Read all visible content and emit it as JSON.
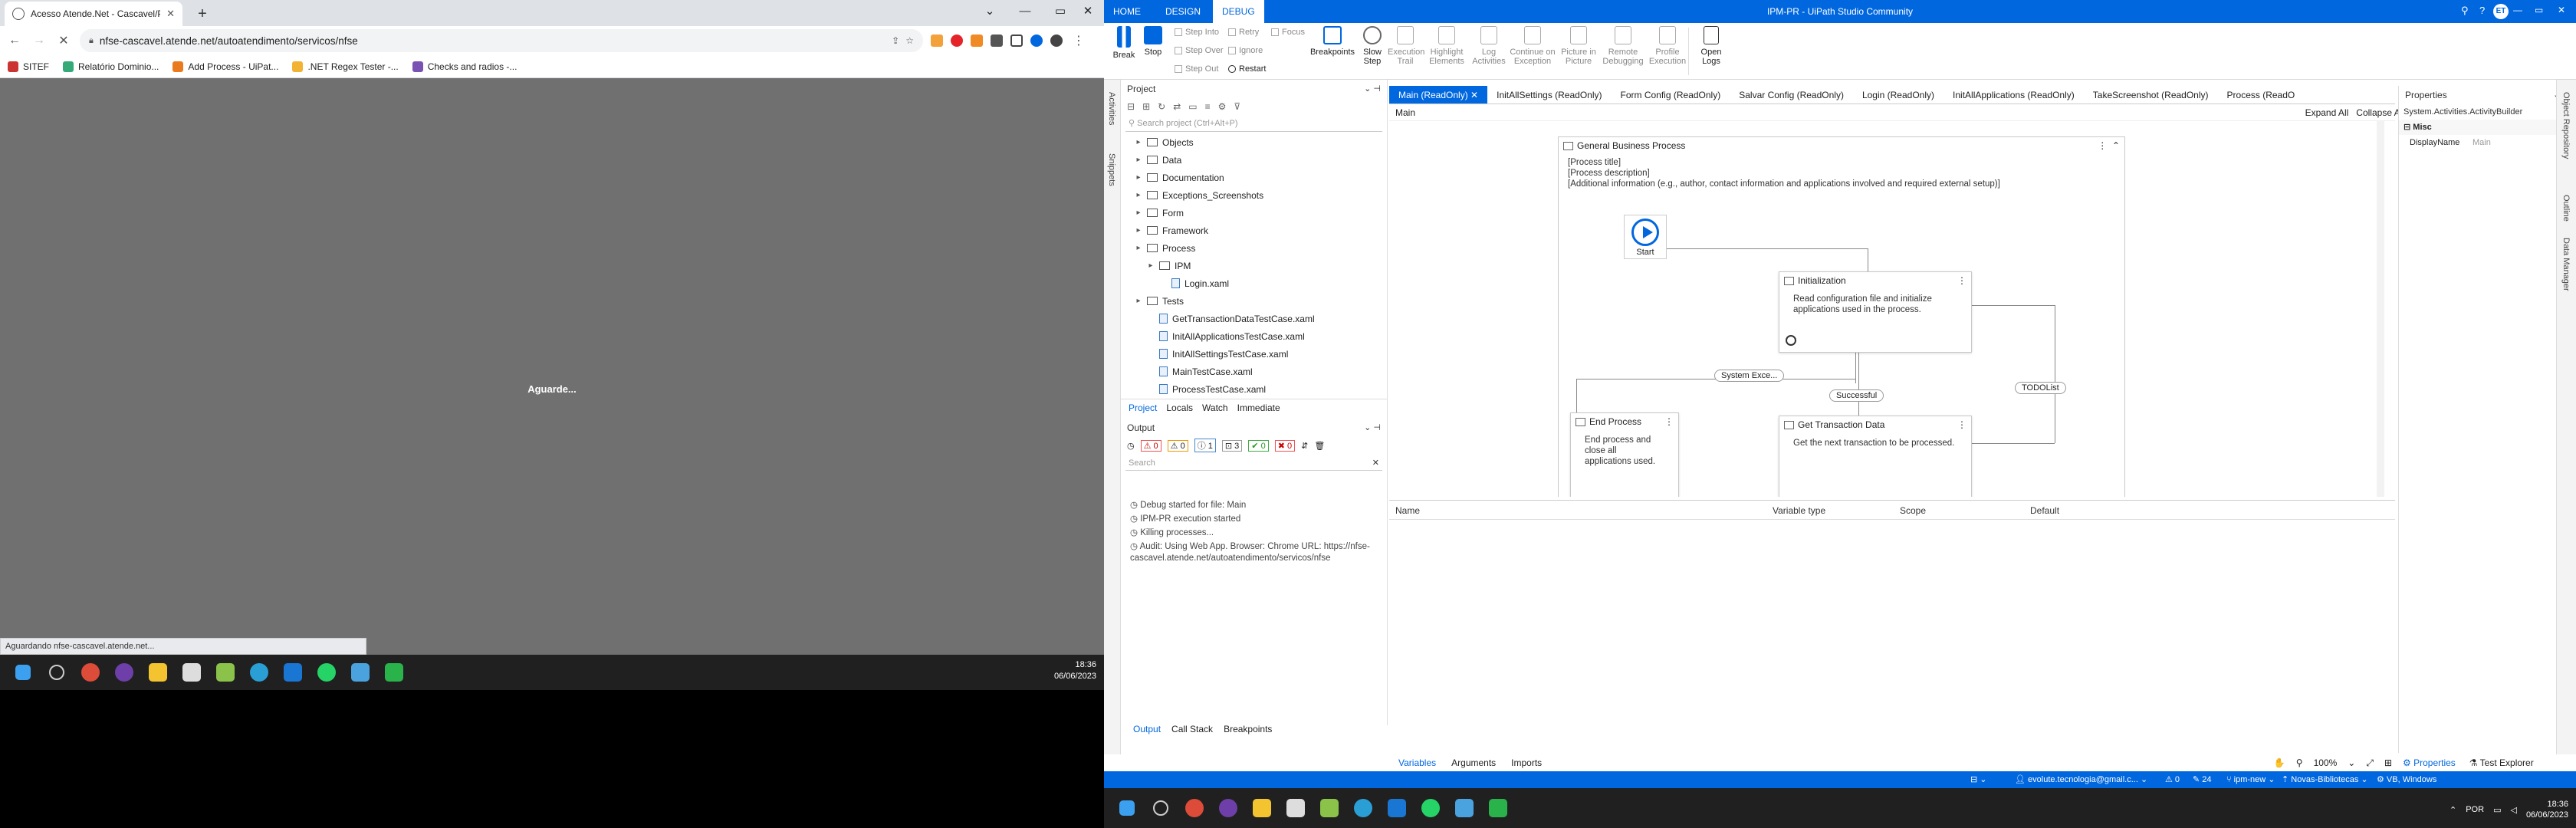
{
  "browser": {
    "tab_title": "Acesso Atende.Net - Cascavel/PR",
    "url": "nfse-cascavel.atende.net/autoatendimento/servicos/nfse",
    "bookmarks": [
      "SITEF",
      "Relatório Dominio...",
      "Add Process - UiPat...",
      ".NET Regex Tester -...",
      "Checks and radios -..."
    ],
    "loading_text": "Aguarde...",
    "status_text": "Aguardando nfse-cascavel.atende.net..."
  },
  "taskbar_left": {
    "time": "18:36",
    "date": "06/06/2023"
  },
  "uipath": {
    "window_title": "IPM-PR - UiPath Studio Community",
    "ribbon_tabs": [
      "HOME",
      "DESIGN",
      "DEBUG"
    ],
    "ribbon": {
      "break": "Break",
      "stop": "Stop",
      "step_into": "Step Into",
      "step_over": "Step Over",
      "step_out": "Step Out",
      "retry": "Retry",
      "ignore": "Ignore",
      "restart": "Restart",
      "focus": "Focus",
      "breakpoints": "Breakpoints",
      "slow_step": "Slow Step",
      "execution_trail": "Execution Trail",
      "highlight_elements": "Highlight Elements",
      "log_activities": "Log Activities",
      "continue_on_exception": "Continue on Exception",
      "picture_in_picture": "Picture in Picture",
      "remote_debugging": "Remote Debugging",
      "profile_execution": "Profile Execution",
      "open_logs": "Open Logs"
    },
    "left_tabs": [
      "Activities",
      "Snippets"
    ],
    "project": {
      "title": "Project",
      "search_placeholder": "Search project (Ctrl+Alt+P)",
      "tree": [
        {
          "label": "Objects",
          "indent": 1,
          "type": "folder"
        },
        {
          "label": "Data",
          "indent": 1,
          "type": "folder"
        },
        {
          "label": "Documentation",
          "indent": 1,
          "type": "folder"
        },
        {
          "label": "Exceptions_Screenshots",
          "indent": 1,
          "type": "folder"
        },
        {
          "label": "Form",
          "indent": 1,
          "type": "folder"
        },
        {
          "label": "Framework",
          "indent": 1,
          "type": "folder"
        },
        {
          "label": "Process",
          "indent": 1,
          "type": "folder"
        },
        {
          "label": "IPM",
          "indent": 2,
          "type": "folder"
        },
        {
          "label": "Login.xaml",
          "indent": 3,
          "type": "file"
        },
        {
          "label": "Tests",
          "indent": 1,
          "type": "folder"
        },
        {
          "label": "GetTransactionDataTestCase.xaml",
          "indent": 2,
          "type": "file"
        },
        {
          "label": "InitAllApplicationsTestCase.xaml",
          "indent": 2,
          "type": "file"
        },
        {
          "label": "InitAllSettingsTestCase.xaml",
          "indent": 2,
          "type": "file"
        },
        {
          "label": "MainTestCase.xaml",
          "indent": 2,
          "type": "file"
        },
        {
          "label": "ProcessTestCase.xaml",
          "indent": 2,
          "type": "file"
        }
      ],
      "bottom_tabs": [
        "Project",
        "Locals",
        "Watch",
        "Immediate"
      ]
    },
    "output": {
      "title": "Output",
      "filters": [
        "0",
        "0",
        "1",
        "3",
        "0",
        "0"
      ],
      "search_placeholder": "Search",
      "logs": [
        "Debug started for file: Main",
        "IPM-PR execution started",
        "Killing processes...",
        "Audit: Using Web App. Browser: Chrome URL: https://nfse-cascavel.atende.net/autoatendimento/servicos/nfse"
      ],
      "bottom_tabs": [
        "Output",
        "Call Stack",
        "Breakpoints"
      ]
    },
    "doc_tabs": [
      "Main (ReadOnly)",
      "InitAllSettings (ReadOnly)",
      "Form Config (ReadOnly)",
      "Salvar Config (ReadOnly)",
      "Login (ReadOnly)",
      "InitAllApplications (ReadOnly)",
      "TakeScreenshot (ReadOnly)",
      "Process (ReadO"
    ],
    "breadcrumb": "Main",
    "expand_all": "Expand All",
    "collapse_all": "Collapse All",
    "designer": {
      "container_title": "General Business Process",
      "container_text": [
        "[Process title]",
        "[Process description]",
        "[Additional information (e.g., author, contact information and applications involved and required external setup)]"
      ],
      "start": "Start",
      "init_title": "Initialization",
      "init_text": "Read configuration file and initialize applications used in the process.",
      "end_title": "End Process",
      "end_text": "End process and close all applications used.",
      "gtd_title": "Get Transaction Data",
      "gtd_text": "Get the next transaction to be processed.",
      "label_system": "System Exce...",
      "label_success": "Successful",
      "label_todo": "TODOList"
    },
    "variables": {
      "headers": [
        "Name",
        "Variable type",
        "Scope",
        "Default"
      ],
      "tabs": [
        "Variables",
        "Arguments",
        "Imports"
      ],
      "zoom": "100%"
    },
    "properties": {
      "title": "Properties",
      "class_name": "System.Activities.ActivityBuilder",
      "section": "Misc",
      "prop_name": "DisplayName",
      "prop_value": "Main",
      "bottom_tabs": [
        "Properties",
        "Test Explorer"
      ]
    },
    "right_tabs": [
      "Object Repository",
      "Outline",
      "Data Manager"
    ],
    "status": {
      "account": "evolute.tecnologia@gmail.c...",
      "errors": "0",
      "count": "24",
      "branch": "ipm-new",
      "library": "Novas-Bibliotecas",
      "runtime": "VB, Windows"
    }
  },
  "taskbar_right": {
    "lang": "POR",
    "time": "18:36",
    "date": "06/06/2023"
  },
  "colors": {
    "accent": "#0067df",
    "chrome_bg": "#707070",
    "taskbar": "#202020"
  }
}
